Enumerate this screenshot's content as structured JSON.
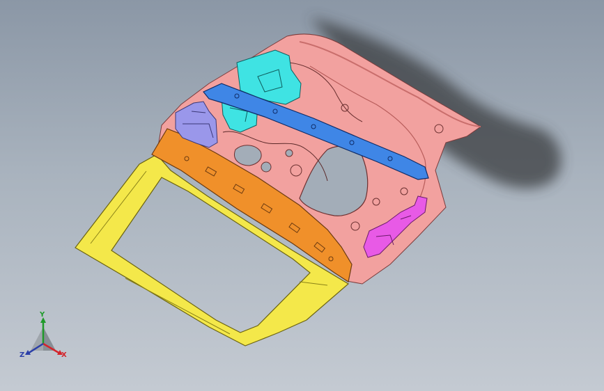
{
  "viewport": {
    "background_top": "#8b97a6",
    "background_bottom": "#c4cad2"
  },
  "model": {
    "part_colors": {
      "inner_panel": "#f2a19f",
      "window_frame": "#f4e84a",
      "reinforcement_bar": "#f0902a",
      "cross_beam": "#3f86e6",
      "hinge_bracket": "#3fe3e3",
      "latch_bracket": "#9a97ea",
      "lock_reinforcement": "#e85ae6",
      "shadow": "#3a3d41"
    }
  },
  "triad": {
    "x_label": "X",
    "y_label": "Y",
    "z_label": "Z",
    "x_color": "#d3242b",
    "y_color": "#1f9a2a",
    "z_color": "#2a3ea8"
  }
}
